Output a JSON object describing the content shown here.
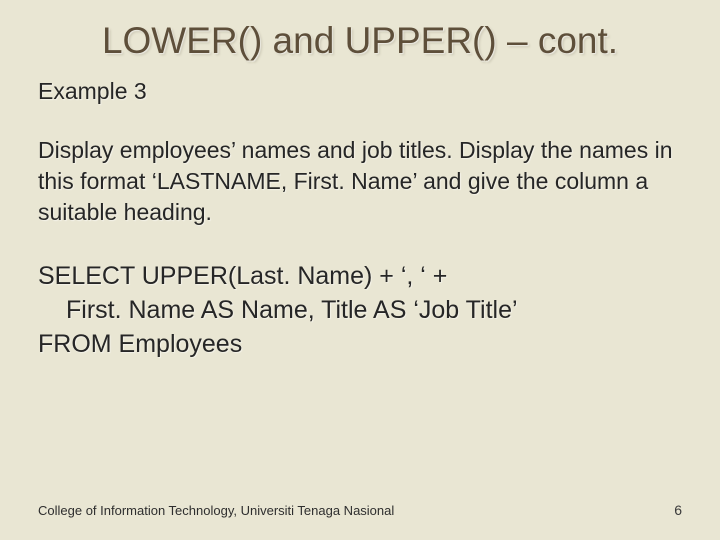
{
  "title": "LOWER() and UPPER() – cont.",
  "example_label": "Example 3",
  "description": "Display employees’ names and job titles. Display the names in this format ‘LASTNAME, First. Name’ and give the column a suitable heading.",
  "code_line1": "SELECT UPPER(Last. Name) + ‘, ‘ +",
  "code_line2": "First. Name AS Name, Title AS ‘Job Title’",
  "code_line3": "FROM Employees",
  "footer_left": "College of Information Technology, Universiti Tenaga Nasional",
  "footer_right": "6"
}
